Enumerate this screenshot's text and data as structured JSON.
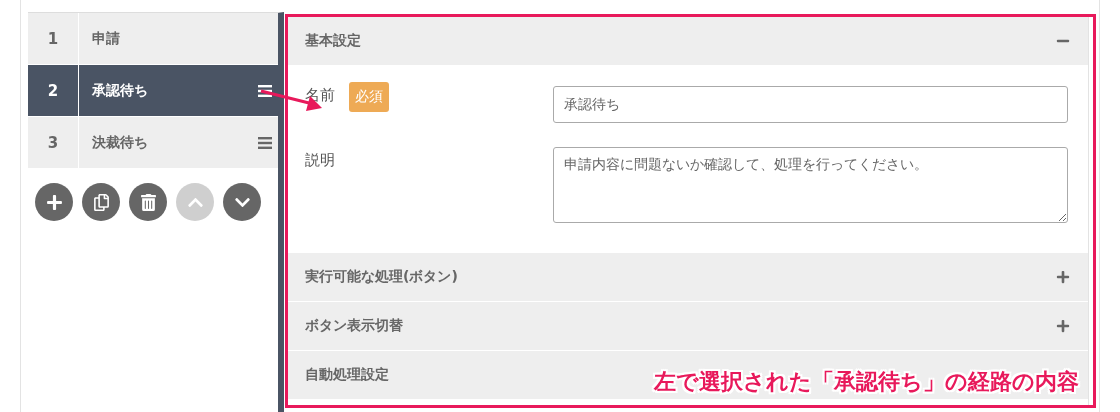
{
  "steps": [
    {
      "number": "1",
      "label": "申請",
      "selected": false,
      "draggable": false
    },
    {
      "number": "2",
      "label": "承認待ち",
      "selected": true,
      "draggable": true
    },
    {
      "number": "3",
      "label": "決裁待ち",
      "selected": false,
      "draggable": true
    }
  ],
  "tools": [
    {
      "kind": "add",
      "disabled": false
    },
    {
      "kind": "copy",
      "disabled": false
    },
    {
      "kind": "delete",
      "disabled": false
    },
    {
      "kind": "up",
      "disabled": true
    },
    {
      "kind": "down",
      "disabled": false
    }
  ],
  "sections": [
    {
      "title": "基本設定",
      "expanded": true,
      "fields": [
        {
          "kind": "input",
          "label": "名前",
          "badge": "必須",
          "value": "承認待ち"
        },
        {
          "kind": "textarea",
          "label": "説明",
          "value": "申請内容に問題ないか確認して、処理を行ってください。"
        }
      ]
    },
    {
      "title": "実行可能な処理(ボタン)",
      "expanded": false
    },
    {
      "title": "ボタン表示切替",
      "expanded": false
    },
    {
      "title": "自動処理設定"
    }
  ],
  "annotation": "左で選択された「承認待ち」の経路の内容"
}
